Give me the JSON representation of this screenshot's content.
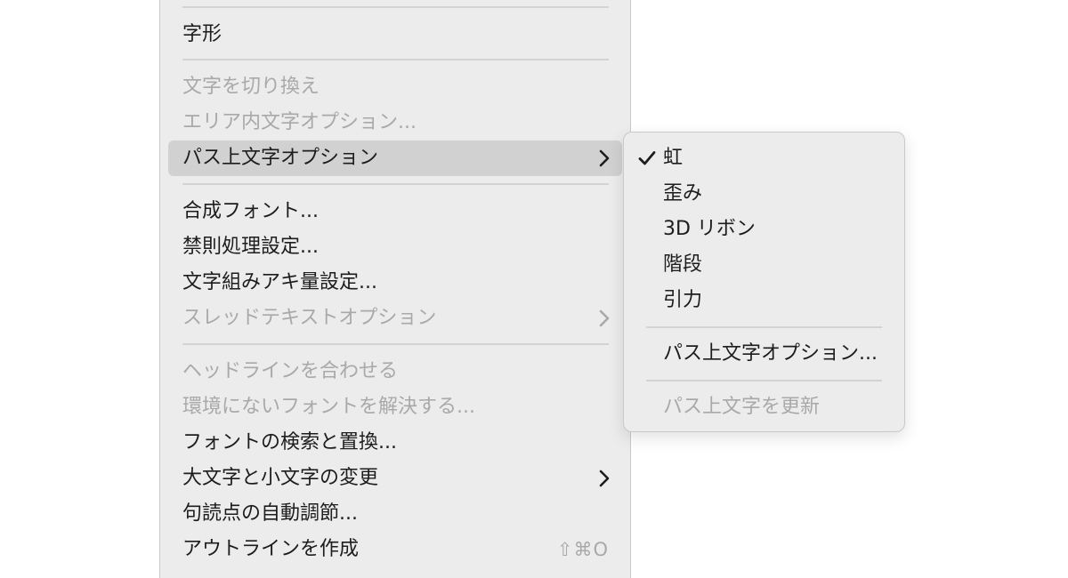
{
  "main_menu": {
    "items": [
      {
        "label": "字形"
      },
      {
        "label": "文字を切り換え"
      },
      {
        "label": "エリア内文字オプション..."
      },
      {
        "label": "パス上文字オプション"
      },
      {
        "label": "合成フォント..."
      },
      {
        "label": "禁則処理設定..."
      },
      {
        "label": "文字組みアキ量設定..."
      },
      {
        "label": "スレッドテキストオプション"
      },
      {
        "label": "ヘッドラインを合わせる"
      },
      {
        "label": "環境にないフォントを解決する..."
      },
      {
        "label": "フォントの検索と置換..."
      },
      {
        "label": "大文字と小文字の変更"
      },
      {
        "label": "句読点の自動調節..."
      },
      {
        "label": "アウトラインを作成",
        "shortcut": "⇧⌘O"
      }
    ]
  },
  "submenu": {
    "items": [
      {
        "label": "虹",
        "checked": true
      },
      {
        "label": "歪み"
      },
      {
        "label": "3D リボン"
      },
      {
        "label": "階段"
      },
      {
        "label": "引力"
      },
      {
        "label": "パス上文字オプション..."
      },
      {
        "label": "パス上文字を更新"
      }
    ]
  },
  "colors": {
    "menu_bg": "#ececec",
    "highlight_bg": "#d1d1d1",
    "text": "#1d1d1d",
    "disabled_text": "#a9a9a9",
    "separator": "#d3d3d3"
  }
}
